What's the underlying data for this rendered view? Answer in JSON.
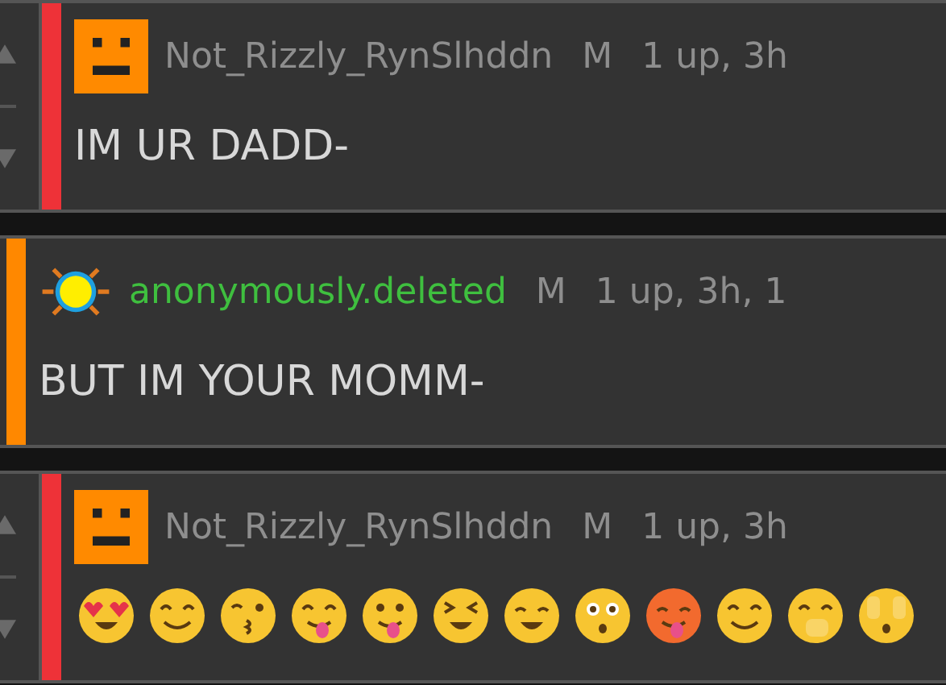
{
  "comments": [
    {
      "votes": true,
      "color": "#ee3238",
      "avatar": {
        "kind": "pixel"
      },
      "user": {
        "name": "Not_Rizzly_RynSlhddn",
        "color": "#8e8e8e"
      },
      "badge": "M",
      "meta": "1 up, 3h",
      "body": "IM UR DADD-"
    },
    {
      "votes": false,
      "color": "#ff8800",
      "avatar": {
        "kind": "sun"
      },
      "user": {
        "name": "anonymously.deleted",
        "color": "#3fbf3f"
      },
      "badge": "M",
      "meta": "1 up, 3h, 1",
      "body": "BUT IM YOUR MOMM-"
    },
    {
      "votes": true,
      "color": "#ee3238",
      "avatar": {
        "kind": "pixel"
      },
      "user": {
        "name": "Not_Rizzly_RynSlhddn",
        "color": "#8e8e8e"
      },
      "badge": "M",
      "meta": "1 up, 3h",
      "emojis": [
        {
          "kind": "heart-eyes"
        },
        {
          "kind": "hearts"
        },
        {
          "kind": "kiss"
        },
        {
          "kind": "yum"
        },
        {
          "kind": "tongue"
        },
        {
          "kind": "tired"
        },
        {
          "kind": "weary"
        },
        {
          "kind": "flushed"
        },
        {
          "kind": "hot"
        },
        {
          "kind": "hug"
        },
        {
          "kind": "giggle"
        },
        {
          "kind": "peek"
        }
      ]
    }
  ]
}
